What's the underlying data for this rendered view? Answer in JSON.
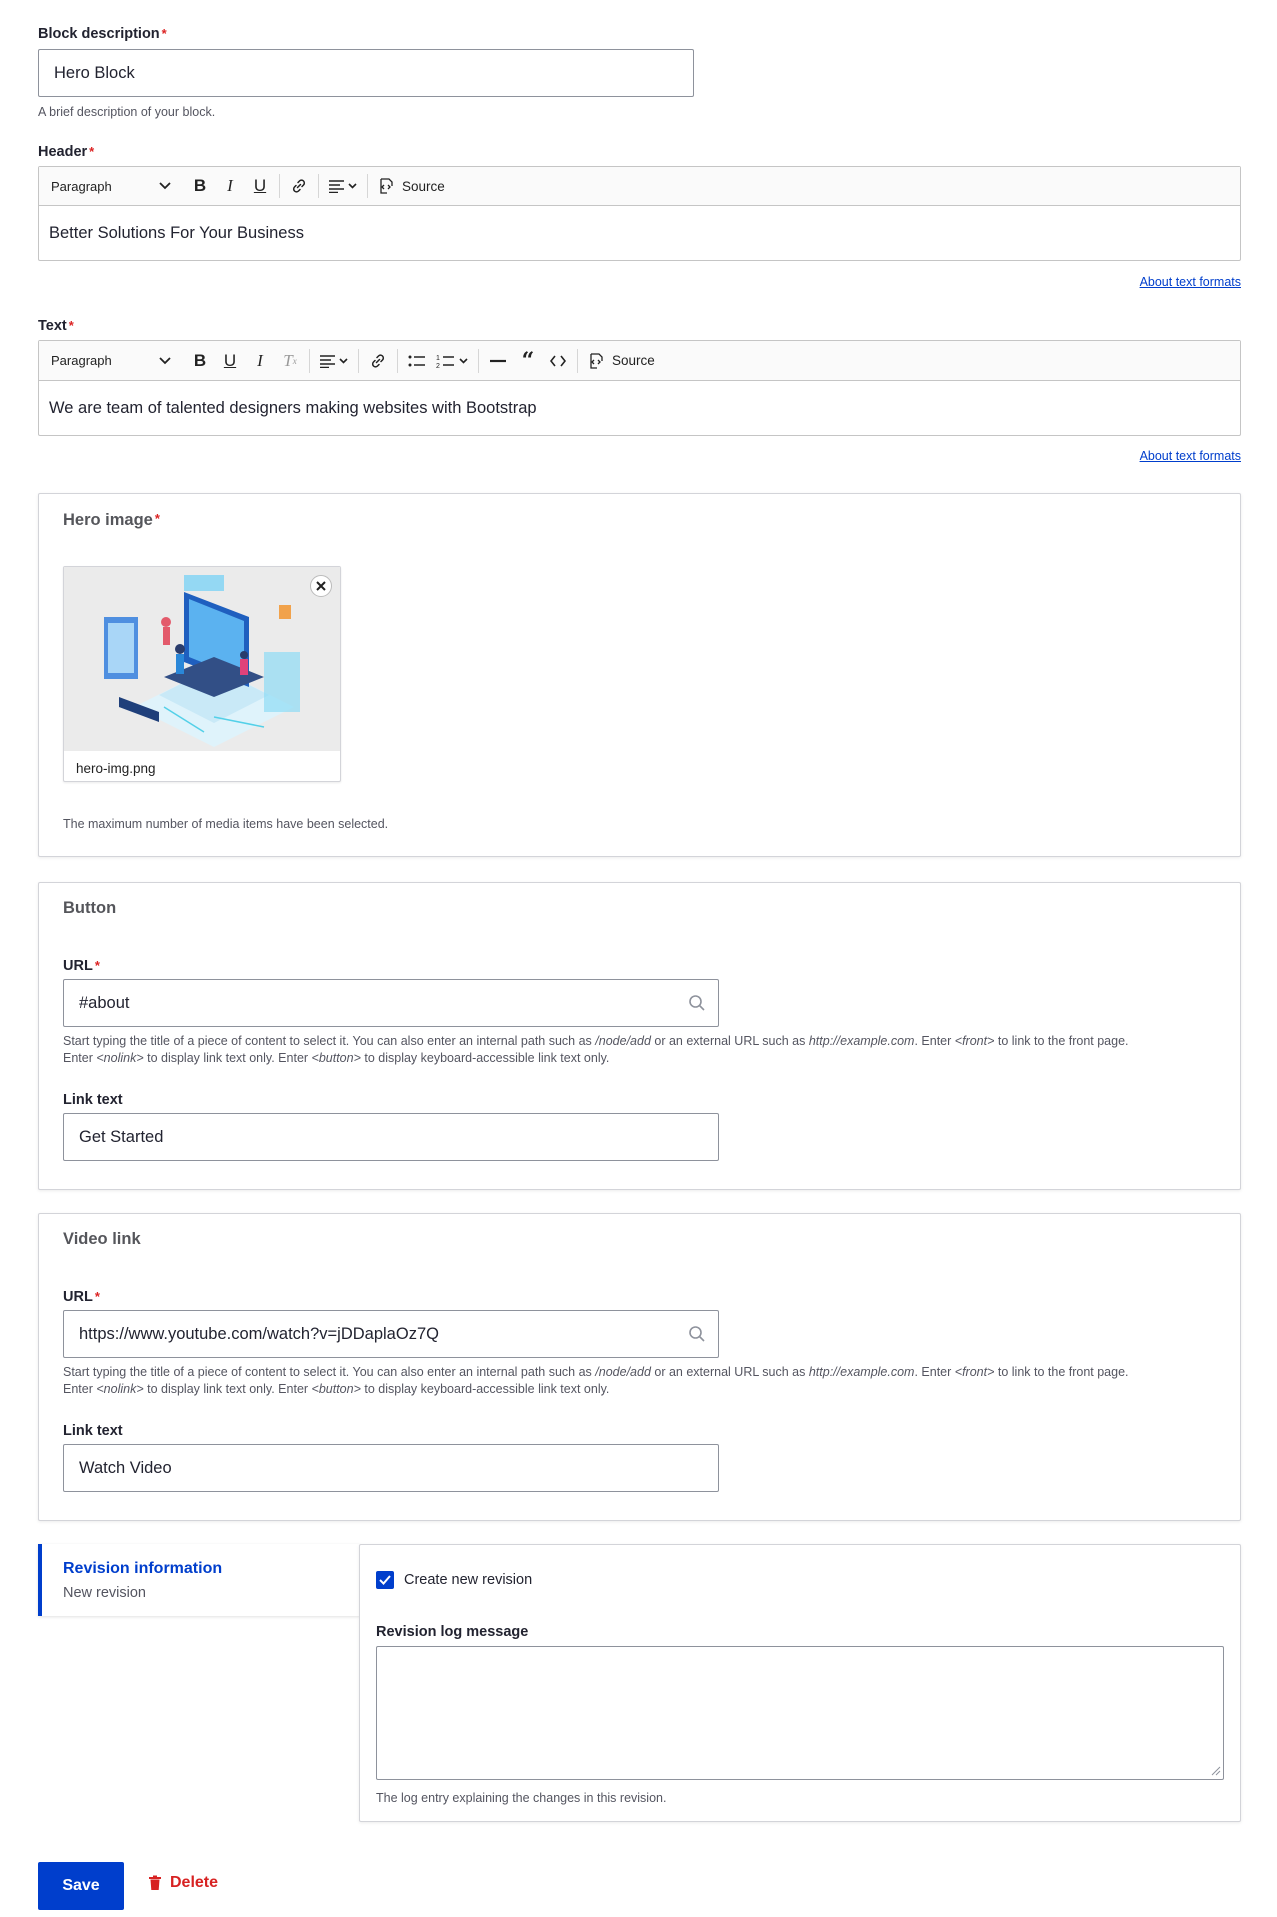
{
  "block_description": {
    "label": "Block description",
    "value": "Hero Block",
    "help": "A brief description of your block."
  },
  "header_field": {
    "label": "Header",
    "format": "Paragraph",
    "source_label": "Source",
    "content": "Better Solutions For Your Business",
    "about_link": "About text formats"
  },
  "text_field": {
    "label": "Text",
    "format": "Paragraph",
    "source_label": "Source",
    "content": "We are team of talented designers making websites with Bootstrap",
    "about_link": "About text formats"
  },
  "hero_image": {
    "title": "Hero image",
    "filename": "hero-img.png",
    "help": "The maximum number of media items have been selected."
  },
  "button_section": {
    "title": "Button",
    "url_label": "URL",
    "url_value": "#about",
    "link_text_label": "Link text",
    "link_text_value": "Get Started"
  },
  "video_section": {
    "title": "Video link",
    "url_label": "URL",
    "url_value": "https://www.youtube.com/watch?v=jDDaplaOz7Q",
    "link_text_label": "Link text",
    "link_text_value": "Watch Video"
  },
  "url_help": {
    "p1": "Start typing the title of a piece of content to select it. You can also enter an internal path such as ",
    "node_add": "/node/add",
    "p2": " or an external URL such as ",
    "example": "http://example.com",
    "p3": ". Enter ",
    "front": "<front>",
    "p4": " to link to the front page.",
    "p5": "Enter ",
    "nolink": "<nolink>",
    "p6": " to display link text only. Enter ",
    "button": "<button>",
    "p7": " to display keyboard-accessible link text only."
  },
  "revision": {
    "tab_title": "Revision information",
    "tab_summary": "New revision",
    "checkbox_label": "Create new revision",
    "checkbox_checked": true,
    "log_label": "Revision log message",
    "log_value": "",
    "log_help": "The log entry explaining the changes in this revision."
  },
  "actions": {
    "save": "Save",
    "delete": "Delete"
  },
  "colors": {
    "primary": "#003ecc",
    "danger": "#d72222",
    "required": "#dc2323"
  }
}
